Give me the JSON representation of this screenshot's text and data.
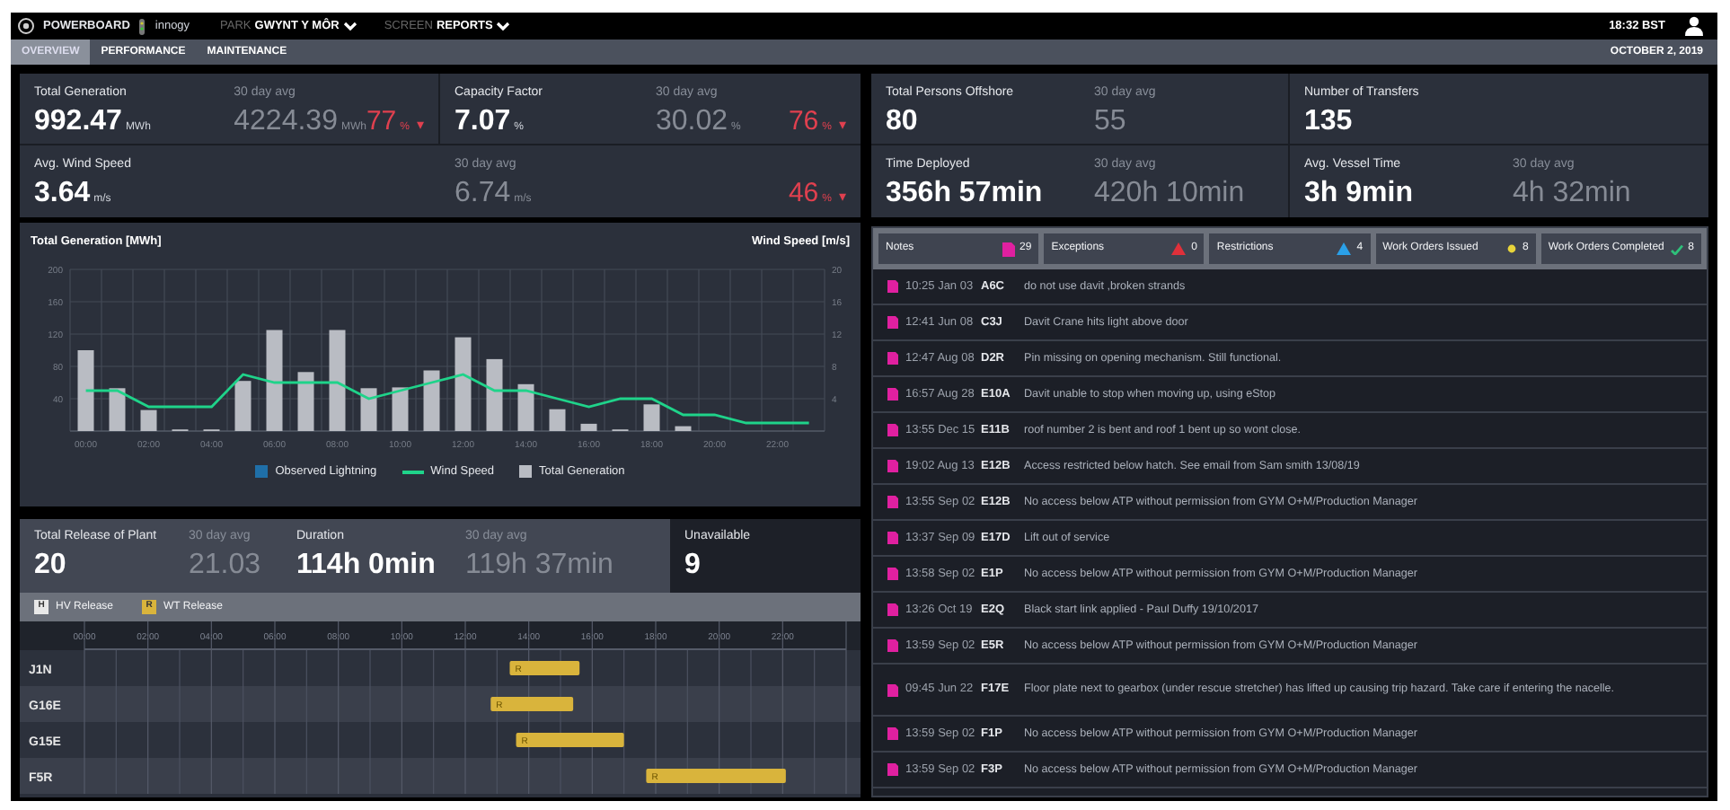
{
  "app": {
    "brand": "POWERBOARD",
    "partner": "innogy",
    "selectors": [
      {
        "label": "PARK",
        "value": "GWYNT Y MÔR"
      },
      {
        "label": "SCREEN",
        "value": "REPORTS"
      }
    ],
    "clock": "18:32 BST"
  },
  "tabs": [
    {
      "label": "OVERVIEW",
      "selected": true
    },
    {
      "label": "PERFORMANCE",
      "selected": false
    },
    {
      "label": "MAINTENANCE",
      "selected": false
    }
  ],
  "date": "OCTOBER 2, 2019",
  "generation_kpis": [
    {
      "label": "Total Generation",
      "value": "992.47",
      "unit": "MWh",
      "avg_label": "30 day avg",
      "avg_value": "4224.39",
      "avg_unit": "MWh",
      "change": "77",
      "change_unit": "%",
      "trend_icon": "▾"
    },
    {
      "label": "Capacity Factor",
      "value": "7.07",
      "unit": "%",
      "avg_label": "30 day avg",
      "avg_value": "30.02",
      "avg_unit": "%",
      "change": "76",
      "change_unit": "%",
      "trend_icon": "▾"
    },
    {
      "label": "Avg. Wind Speed",
      "value": "3.64",
      "unit": "m/s",
      "avg_label": "30 day avg",
      "avg_value": "6.74",
      "avg_unit": "m/s",
      "change": "46",
      "change_unit": "%",
      "trend_icon": "▾"
    }
  ],
  "generation_chart": {
    "chart_data": {
      "type": "bar",
      "ylabel": "Total Generation [MWh]",
      "y2label": "Wind Speed [m/s]",
      "x": [
        0,
        1,
        2,
        3,
        4,
        5,
        6,
        7,
        8,
        9,
        10,
        11,
        12,
        13,
        14,
        15,
        16,
        17,
        18,
        19,
        20,
        21,
        22,
        23
      ],
      "xlim": [
        -0.5,
        23.5
      ],
      "xticks": [
        {
          "value": 0,
          "label": "00:00"
        },
        {
          "value": 2,
          "label": "02:00"
        },
        {
          "value": 4,
          "label": "04:00"
        },
        {
          "value": 6,
          "label": "06:00"
        },
        {
          "value": 8,
          "label": "08:00"
        },
        {
          "value": 10,
          "label": "10:00"
        },
        {
          "value": 12,
          "label": "12:00"
        },
        {
          "value": 14,
          "label": "14:00"
        },
        {
          "value": 16,
          "label": "16:00"
        },
        {
          "value": 18,
          "label": "18:00"
        },
        {
          "value": 20,
          "label": "20:00"
        },
        {
          "value": 22,
          "label": "22:00"
        }
      ],
      "grid": true,
      "ylim": [
        0,
        200
      ],
      "yticks": [
        40,
        80,
        120,
        160,
        200
      ],
      "y2lim": [
        0,
        20
      ],
      "y2ticks": [
        4,
        8,
        12,
        16,
        20
      ],
      "series": [
        {
          "name": "Observed Lightning",
          "type": "bar",
          "color": "#1f6fa8",
          "values": [
            null,
            null,
            null,
            null,
            null,
            null,
            null,
            null,
            null,
            null,
            null,
            null,
            null,
            null,
            null,
            null,
            null,
            null,
            null,
            null,
            null,
            null,
            null,
            null
          ]
        },
        {
          "name": "Wind Speed",
          "type": "line",
          "axis": "y2",
          "color": "#1fd38a",
          "values": [
            5,
            5,
            3,
            3,
            3,
            7,
            6,
            6,
            6,
            4,
            5,
            6,
            7,
            5,
            5,
            4,
            3,
            4,
            4,
            2,
            2,
            1,
            1,
            1
          ]
        },
        {
          "name": "Total Generation",
          "type": "bar",
          "color": "#b9bcc3",
          "values": [
            100,
            53,
            26,
            2,
            2,
            62,
            125,
            73,
            125,
            53,
            54,
            75,
            116,
            89,
            58,
            27,
            9,
            2,
            33,
            6,
            0,
            0,
            0,
            0
          ]
        }
      ]
    }
  },
  "release": {
    "kpis": [
      {
        "label": "Total Release of Plant",
        "value": "20",
        "avg_label": "30 day avg",
        "avg_value": "21.03"
      },
      {
        "label": "Duration",
        "value": "114h 0min",
        "avg_label": "30 day avg",
        "avg_value": "119h 37min"
      }
    ],
    "unavailable": {
      "label": "Unavailable",
      "value": "9"
    },
    "legend": [
      {
        "letter": "H"
      },
      {
        "letter": "R"
      }
    ],
    "chart_data": {
      "type": "bar",
      "orientation": "horizontal",
      "grid": true,
      "categories": [
        "J1N",
        "G16E",
        "G15E",
        "F5R"
      ],
      "xlim": [
        0,
        24
      ],
      "xticks": [
        {
          "value": 0,
          "label": "00:00"
        },
        {
          "value": 2,
          "label": "02:00"
        },
        {
          "value": 4,
          "label": "04:00"
        },
        {
          "value": 6,
          "label": "06:00"
        },
        {
          "value": 8,
          "label": "08:00"
        },
        {
          "value": 10,
          "label": "10:00"
        },
        {
          "value": 12,
          "label": "12:00"
        },
        {
          "value": 14,
          "label": "14:00"
        },
        {
          "value": 16,
          "label": "16:00"
        },
        {
          "value": 18,
          "label": "18:00"
        },
        {
          "value": 20,
          "label": "20:00"
        },
        {
          "value": 22,
          "label": "22:00"
        }
      ],
      "stacked": true,
      "series": [
        {
          "name": "HV Release",
          "color": "#e8e8e8",
          "base": [
            null,
            null,
            null,
            null
          ],
          "values": [
            null,
            null,
            null,
            null
          ]
        },
        {
          "name": "WT Release",
          "color": "#d9b43c",
          "base": [
            13.4,
            12.8,
            13.6,
            17.7
          ],
          "values": [
            2.2,
            2.6,
            3.4,
            4.4
          ]
        }
      ],
      "value_labels": [
        "R",
        "R",
        "R",
        "R"
      ]
    }
  },
  "offshore_kpis": [
    {
      "label": "Total Persons Offshore",
      "value": "80",
      "avg_label": "30 day avg",
      "avg_value": "55"
    },
    {
      "label": "Number of Transfers",
      "value": "135"
    },
    {
      "label": "Time Deployed",
      "value": "356h 57min",
      "avg_label": "30 day avg",
      "avg_value": "420h 10min"
    },
    {
      "label": "Avg. Vessel Time",
      "value": "3h 9min",
      "avg_label": "30 day avg",
      "avg_value": "4h 32min"
    }
  ],
  "log_tabs": [
    {
      "label": "Notes",
      "kind": "note",
      "count": "29"
    },
    {
      "label": "Exceptions",
      "kind": "exception",
      "count": "0"
    },
    {
      "label": "Restrictions",
      "kind": "restriction",
      "count": "4"
    },
    {
      "label": "Work Orders Issued",
      "kind": "issued",
      "count": "8"
    },
    {
      "label": "Work Orders Completed",
      "kind": "completed",
      "count": "8"
    }
  ],
  "notes": [
    {
      "time": "10:25 Jan 03",
      "asset": "A6C",
      "text": "do not use davit ,broken strands"
    },
    {
      "time": "12:41 Jun 08",
      "asset": "C3J",
      "text": "Davit Crane hits light above door"
    },
    {
      "time": "12:47 Aug 08",
      "asset": "D2R",
      "text": "Pin missing on opening mechanism. Still functional."
    },
    {
      "time": "16:57 Aug 28",
      "asset": "E10A",
      "text": "Davit unable to stop when moving up, using eStop"
    },
    {
      "time": "13:55 Dec 15",
      "asset": "E11B",
      "text": "roof number 2 is bent and roof 1 bent up so wont close."
    },
    {
      "time": "19:02 Aug 13",
      "asset": "E12B",
      "text": "Access restricted below hatch. See email from Sam smith 13/08/19"
    },
    {
      "time": "13:55 Sep 02",
      "asset": "E12B",
      "text": "No access below ATP without permission from GYM O+M/Production Manager"
    },
    {
      "time": "13:37 Sep 09",
      "asset": "E17D",
      "text": "Lift out of service"
    },
    {
      "time": "13:58 Sep 02",
      "asset": "E1P",
      "text": "No access below ATP without permission from GYM O+M/Production Manager"
    },
    {
      "time": "13:26 Oct 19",
      "asset": "E2Q",
      "text": "Black start link applied - Paul Duffy 19/10/2017"
    },
    {
      "time": "13:59 Sep 02",
      "asset": "E5R",
      "text": "No access below ATP without permission from GYM O+M/Production Manager"
    },
    {
      "time": "09:45 Jun 22",
      "asset": "F17E",
      "text": "Floor plate next to gearbox (under rescue stretcher) has lifted up causing trip hazard. Take care if entering the nacelle."
    },
    {
      "time": "13:59 Sep 02",
      "asset": "F1P",
      "text": "No access below ATP without permission from GYM O+M/Production Manager"
    },
    {
      "time": "13:59 Sep 02",
      "asset": "F3P",
      "text": "No access below ATP without permission from GYM O+M/Production Manager"
    }
  ]
}
